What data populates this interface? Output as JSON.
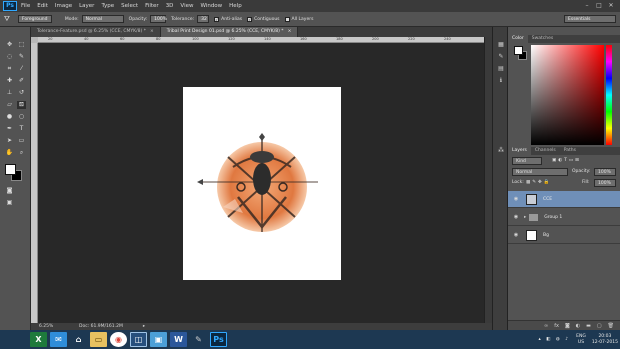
{
  "app": {
    "logo": "Ps",
    "menu": [
      "File",
      "Edit",
      "Image",
      "Layer",
      "Type",
      "Select",
      "Filter",
      "3D",
      "View",
      "Window",
      "Help"
    ]
  },
  "window_controls": {
    "minimize": "–",
    "maximize": "□",
    "close": "✕"
  },
  "options": {
    "preset": "Foreground",
    "mode_label": "Mode:",
    "mode_value": "Normal",
    "opacity_label": "Opacity:",
    "opacity_value": "100%",
    "tolerance_label": "Tolerance:",
    "tolerance_value": "32",
    "antialias_label": "Anti-alias",
    "contiguous_label": "Contiguous",
    "all_layers_label": "All Layers",
    "workspace": "Essentials"
  },
  "tabs": [
    {
      "label": "Tolerance-Feature.psd @ 6.25% (CCE, CMYK/8) *",
      "close": "×"
    },
    {
      "label": "Tribal Print Design 01.psd @ 6.25% (CCE, CMYK/8) *",
      "close": "×"
    }
  ],
  "ruler_ticks": [
    "20",
    "40",
    "60",
    "80",
    "100",
    "120",
    "140",
    "160",
    "180",
    "200",
    "220",
    "240"
  ],
  "status": {
    "zoom": "6.25%",
    "doc": "Doc: 61.9M/161.2M"
  },
  "color_panel": {
    "tabs": [
      "Color",
      "Swatches"
    ]
  },
  "layers_panel": {
    "tabs": [
      "Layers",
      "Channels",
      "Paths"
    ],
    "kind": "Kind",
    "blend": "Normal",
    "opacity_label": "Opacity:",
    "opacity_value": "100%",
    "lock_label": "Lock:",
    "fill_label": "Fill:",
    "fill_value": "100%",
    "layers": [
      {
        "name": "CCE",
        "selected": true
      },
      {
        "name": "Group 1",
        "selected": false
      },
      {
        "name": "Bg",
        "selected": false
      }
    ]
  },
  "taskbar": {
    "apps": [
      "excel",
      "outlook",
      "home",
      "explorer",
      "chrome",
      "meeting",
      "photos",
      "word",
      "paint",
      "photoshop"
    ],
    "language": "ENG",
    "region": "US",
    "time": "20:03",
    "date": "12-07-2015"
  }
}
